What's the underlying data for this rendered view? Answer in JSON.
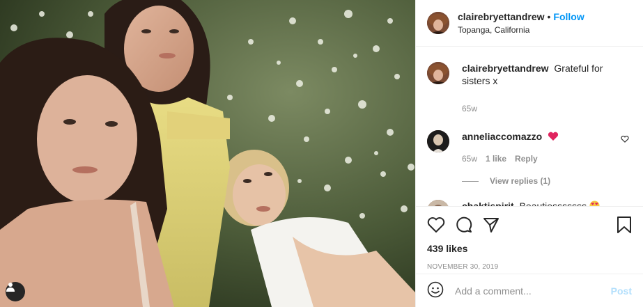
{
  "header": {
    "username": "clairebryettandrew",
    "separator": "•",
    "follow_label": "Follow",
    "location": "Topanga, California"
  },
  "caption": {
    "username": "clairebryettandrew",
    "text": "Grateful for sisters x",
    "age": "65w"
  },
  "comments": [
    {
      "username": "anneliaccomazzo",
      "text": "",
      "emoji": "heart",
      "age": "65w",
      "likes": "1 like",
      "reply_label": "Reply",
      "view_replies": "View replies (1)"
    },
    {
      "username": "chaktispirit",
      "text": "Beautiesssssss",
      "emoji": "heart-eyes"
    }
  ],
  "actions": {
    "icons": [
      "heart-icon",
      "comment-icon",
      "share-icon",
      "save-icon"
    ],
    "likes": "439 likes",
    "date": "NOVEMBER 30, 2019"
  },
  "add_comment": {
    "placeholder": "Add a comment...",
    "post_label": "Post"
  },
  "colors": {
    "accent": "#0095f6",
    "post_disabled": "#b2dffc",
    "like_red": "#ed4956"
  }
}
